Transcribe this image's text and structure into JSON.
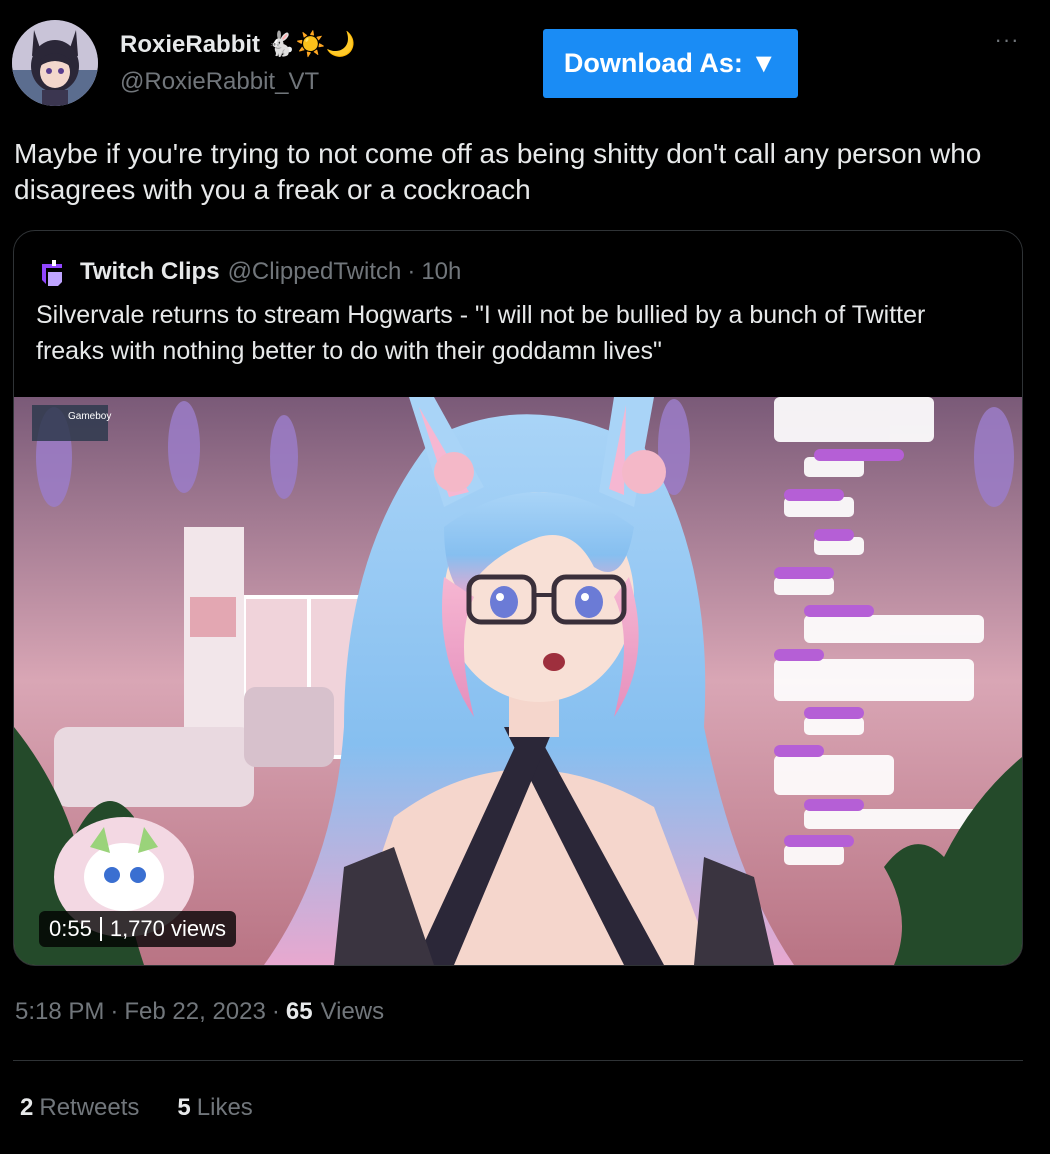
{
  "author": {
    "name": "RoxieRabbit",
    "name_emoji": "🐇☀️🌙",
    "handle": "@RoxieRabbit_VT"
  },
  "actions": {
    "download_label": "Download As: ▼",
    "more_icon": "more-horizontal-icon"
  },
  "tweet": {
    "text": "Maybe if you're trying to not come off as being shitty don't call any person who disagrees with you a freak or a cockroach"
  },
  "quote": {
    "name": "Twitch Clips",
    "handle": "@ClippedTwitch",
    "dot": "·",
    "time": "10h",
    "text": "Silvervale returns to stream Hogwarts - \"I will not be bullied by a bunch of Twitter freaks with nothing better to do with their goddamn lives\"",
    "video": {
      "duration": "0:55",
      "views": "1,770 views",
      "overlay_label": "Gameboy"
    }
  },
  "meta": {
    "time": "5:18 PM",
    "date": "Feb 22, 2023",
    "sep": "·",
    "views_count": "65",
    "views_label": "Views"
  },
  "stats": {
    "retweets_count": "2",
    "retweets_label": "Retweets",
    "likes_count": "5",
    "likes_label": "Likes"
  },
  "colors": {
    "background": "#000000",
    "text": "#e7e9ea",
    "muted": "#71767b",
    "border": "#2f3336",
    "download_button": "#1a8cf5",
    "twitch_purple": "#9146ff"
  }
}
